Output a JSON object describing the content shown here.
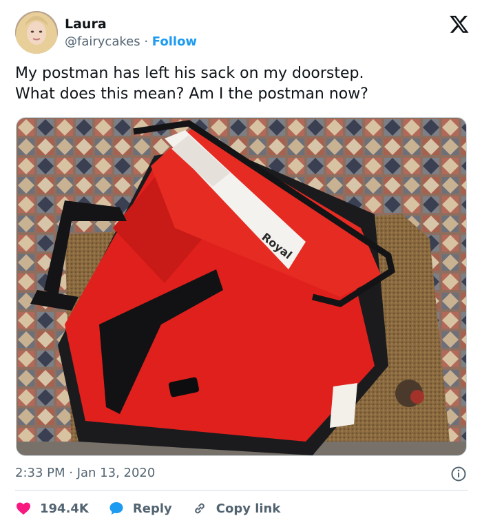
{
  "author": {
    "name": "Laura",
    "handle": "@fairycakes",
    "separator": "·",
    "follow_label": "Follow"
  },
  "tweet": {
    "text": "My postman has left his sack on my doorstep.\nWhat does this mean? Am I the postman now?",
    "timestamp": "2:33 PM · Jan 13, 2020",
    "image_text": "Royal"
  },
  "actions": {
    "likes": "194.4K",
    "reply_label": "Reply",
    "copy_link_label": "Copy link"
  },
  "colors": {
    "like": "#f91880",
    "reply": "#1d9bf0",
    "link": "#1d9bf0",
    "muted": "#536471",
    "bag_red": "#e0201c"
  },
  "icons": {
    "platform": "x-logo-icon",
    "info": "info-icon",
    "like": "heart-icon",
    "reply": "reply-bubble-icon",
    "copy": "link-icon"
  }
}
